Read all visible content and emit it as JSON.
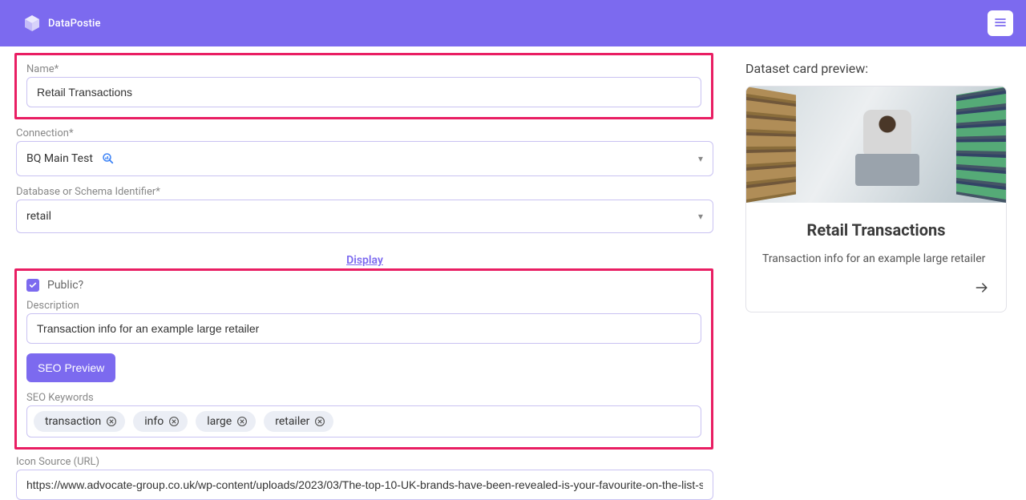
{
  "header": {
    "brand": "DataPostie"
  },
  "form": {
    "name_label": "Name*",
    "name_value": "Retail Transactions",
    "connection_label": "Connection*",
    "connection_value": "BQ Main Test",
    "schema_label": "Database or Schema Identifier*",
    "schema_value": "retail",
    "display_section": "Display",
    "public_label": "Public?",
    "public_checked": true,
    "description_label": "Description",
    "description_value": "Transaction info for an example large retailer",
    "seo_preview_btn": "SEO Preview",
    "seo_keywords_label": "SEO Keywords",
    "keywords": [
      "transaction",
      "info",
      "large",
      "retailer"
    ],
    "icon_source_label": "Icon Source (URL)",
    "icon_source_value": "https://www.advocate-group.co.uk/wp-content/uploads/2023/03/The-top-10-UK-brands-have-been-revealed-is-your-favourite-on-the-list-scaled.jpg"
  },
  "preview": {
    "heading": "Dataset card preview:",
    "card_title": "Retail Transactions",
    "card_desc": "Transaction info for an example large retailer"
  }
}
